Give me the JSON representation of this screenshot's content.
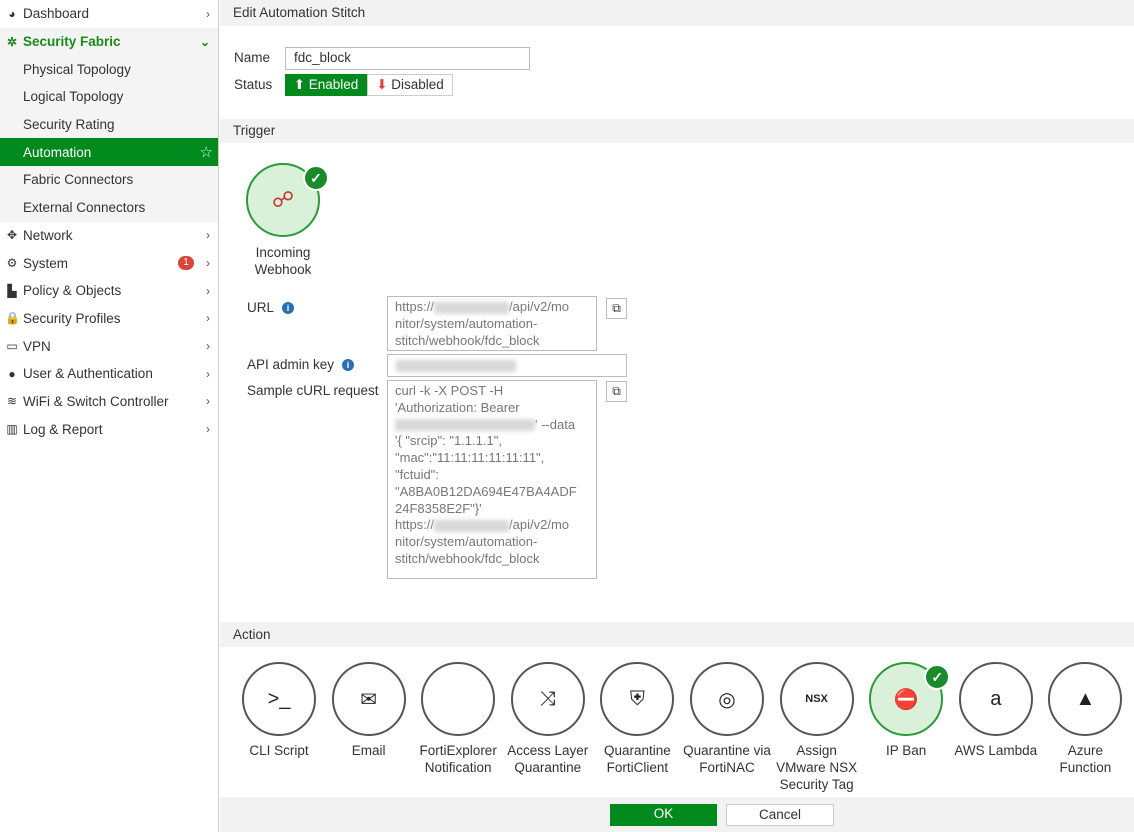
{
  "sidebar": {
    "items": [
      {
        "label": "Dashboard",
        "icon": "dashboard-icon"
      },
      {
        "label": "Security Fabric",
        "icon": "fabric-icon"
      },
      {
        "label": "Physical Topology"
      },
      {
        "label": "Logical Topology"
      },
      {
        "label": "Security Rating"
      },
      {
        "label": "Automation"
      },
      {
        "label": "Fabric Connectors"
      },
      {
        "label": "External Connectors"
      },
      {
        "label": "Network",
        "icon": "network-icon"
      },
      {
        "label": "System",
        "icon": "gear-icon",
        "badge": "1"
      },
      {
        "label": "Policy & Objects",
        "icon": "policy-icon"
      },
      {
        "label": "Security Profiles",
        "icon": "lock-icon"
      },
      {
        "label": "VPN",
        "icon": "laptop-icon"
      },
      {
        "label": "User & Authentication",
        "icon": "user-icon"
      },
      {
        "label": "WiFi & Switch Controller",
        "icon": "wifi-icon"
      },
      {
        "label": "Log & Report",
        "icon": "chart-icon"
      }
    ]
  },
  "header": {
    "title": "Edit Automation Stitch"
  },
  "form": {
    "name_label": "Name",
    "name_value": "fdc_block",
    "status_label": "Status",
    "enabled": "Enabled",
    "disabled": "Disabled"
  },
  "trigger": {
    "section": "Trigger",
    "name_line1": "Incoming",
    "name_line2": "Webhook",
    "url_label": "URL",
    "url_prefix": "https://",
    "url_rest": "/api/v2/mo\nnitor/system/automation-\nstitch/webhook/fdc_block",
    "api_label": "API admin key",
    "curl_label": "Sample cURL request",
    "curl_1": "curl -k -X POST -H\n'Authorization: Bearer\n",
    "curl_2": "' --data\n'{ \"srcip\": \"1.1.1.1\",\n\"mac\":\"11:11:11:11:11:11\",\n\"fctuid\":\n\"A8BA0B12DA694E47BA4ADF\n24F8358E2F\"}'\nhttps://",
    "curl_3": "/api/v2/mo\nnitor/system/automation-\nstitch/webhook/fdc_block"
  },
  "action": {
    "section": "Action",
    "items": [
      {
        "label": "CLI Script",
        "glyph": ">_"
      },
      {
        "label": "Email",
        "glyph": "✉"
      },
      {
        "label": "FortiExplorer Notification",
        "glyph": ""
      },
      {
        "label": "Access Layer Quarantine",
        "glyph": "⤨"
      },
      {
        "label": "Quarantine FortiClient",
        "glyph": "⛨"
      },
      {
        "label": "Quarantine via FortiNAC",
        "glyph": "◎"
      },
      {
        "label": "Assign VMware NSX Security Tag",
        "glyph": "NSX"
      },
      {
        "label": "IP Ban",
        "glyph": "⛔",
        "selected": true
      },
      {
        "label": "AWS Lambda",
        "glyph": "a"
      },
      {
        "label": "Azure Function",
        "glyph": "▲"
      }
    ]
  },
  "footer": {
    "ok": "OK",
    "cancel": "Cancel"
  },
  "colors": {
    "accent": "#008a1e",
    "danger": "#d9453d"
  }
}
